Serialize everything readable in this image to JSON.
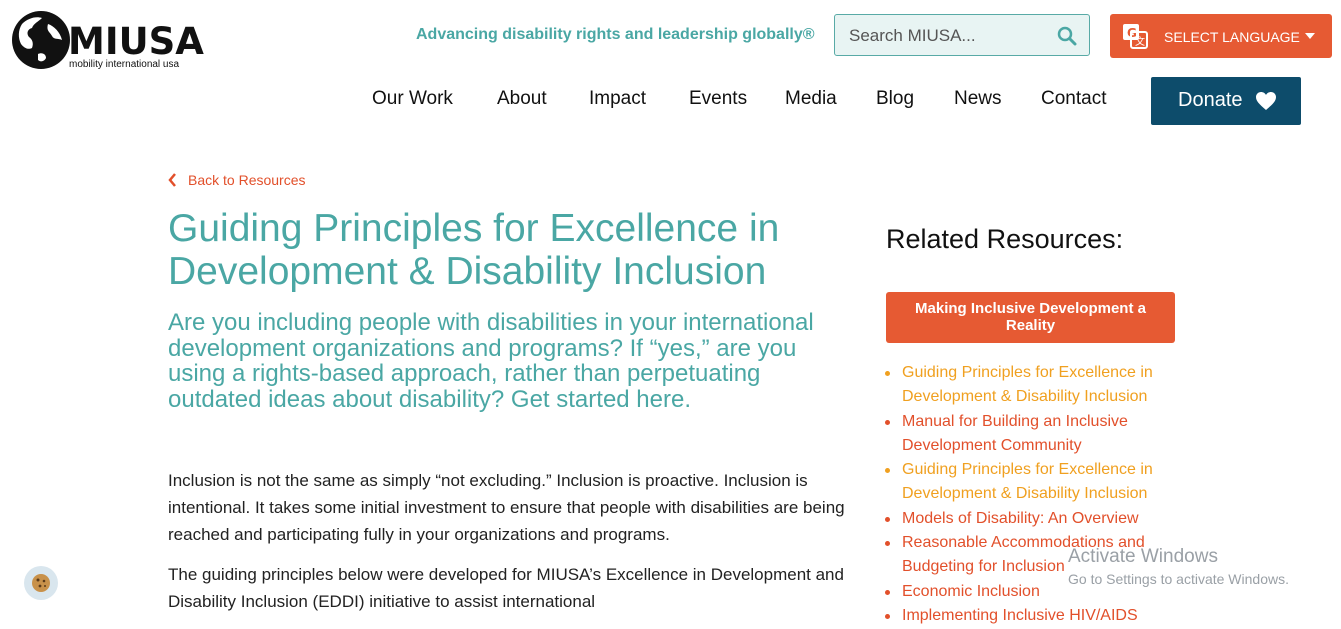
{
  "header": {
    "logo_text": "MIUSA",
    "logo_subtext": "mobility international usa",
    "tagline": "Advancing disability rights and leadership globally®",
    "search_placeholder": "Search MIUSA...",
    "language_label": "SELECT LANGUAGE",
    "nav": [
      "Our Work",
      "About",
      "Impact",
      "Events",
      "Media",
      "Blog",
      "News",
      "Contact"
    ],
    "donate_label": "Donate"
  },
  "main": {
    "back_label": "Back to Resources",
    "title": "Guiding Principles for Excellence in Development & Disability Inclusion",
    "lead": "Are you including people with disabilities in your international development organizations and programs? If “yes,” are you using a rights-based approach, rather than perpetuating outdated ideas about disability? Get started here.",
    "paragraphs": [
      "Inclusion is not the same as simply “not excluding.” Inclusion is proactive. Inclusion is intentional. It takes some initial investment to ensure that people with disabilities are being reached and participating fully in your organizations and programs.",
      "The guiding principles below were developed for MIUSA’s Excellence in Development and Disability Inclusion (EDDI) initiative to assist international"
    ]
  },
  "sidebar": {
    "title": "Related Resources:",
    "featured": "Making Inclusive Development a Reality",
    "items": [
      {
        "label": "Guiding Principles for Excellence in Development & Disability Inclusion",
        "color": "#f0a020"
      },
      {
        "label": "Manual for Building an Inclusive Development Community",
        "color": "#e2502b"
      },
      {
        "label": "Guiding Principles for Excellence in Development & Disability Inclusion",
        "color": "#f0a020"
      },
      {
        "label": "Models of Disability: An Overview",
        "color": "#e2502b"
      },
      {
        "label": "Reasonable Accommodations and Budgeting for Inclusion",
        "color": "#e2502b"
      },
      {
        "label": "Economic Inclusion",
        "color": "#e2502b"
      },
      {
        "label": "Implementing Inclusive HIV/AIDS",
        "color": "#e2502b"
      }
    ]
  },
  "overlay": {
    "activate_title": "Activate Windows",
    "activate_sub": "Go to Settings to activate Windows."
  },
  "colors": {
    "accent_teal": "#4aa7a4",
    "accent_orange": "#e65a33",
    "donate_navy": "#0d4c6b"
  }
}
